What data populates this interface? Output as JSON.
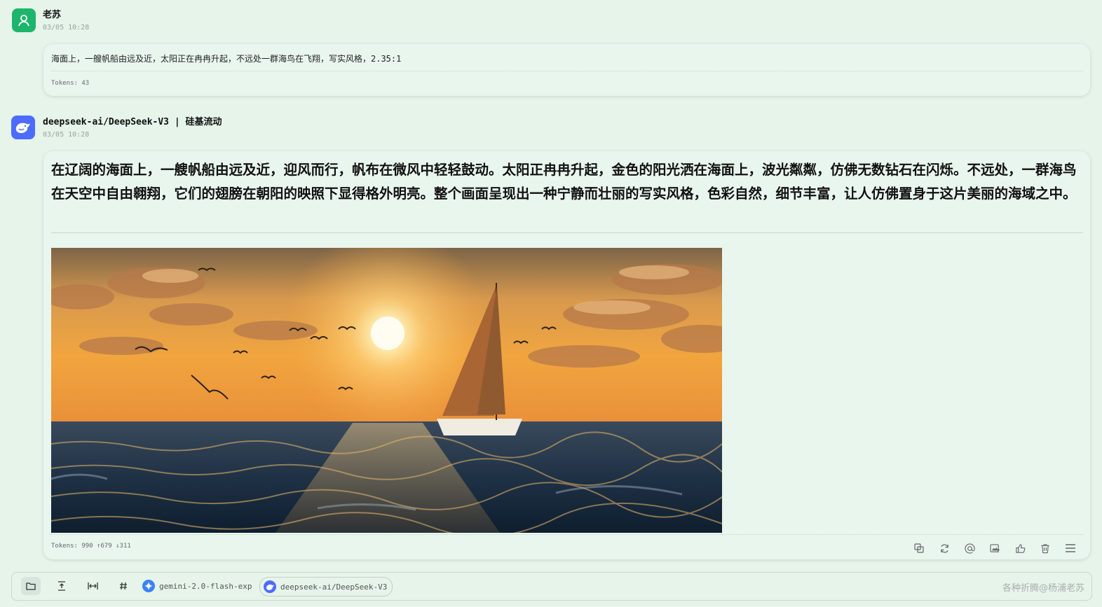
{
  "user_message": {
    "author": "老苏",
    "time": "03/05 10:28",
    "text": "海面上，一艘帆船由远及近，太阳正在冉冉升起，不远处一群海鸟在飞翔，写实风格，2.35:1",
    "tokens": "Tokens: 43"
  },
  "bot_message": {
    "author": "deepseek-ai/DeepSeek-V3 | 硅基流动",
    "time": "03/05 10:28",
    "text": "在辽阔的海面上，一艘帆船由远及近，迎风而行，帆布在微风中轻轻鼓动。太阳正冉冉升起，金色的阳光洒在海面上，波光粼粼，仿佛无数钻石在闪烁。不远处，一群海鸟在天空中自由翱翔，它们的翅膀在朝阳的映照下显得格外明亮。整个画面呈现出一种宁静而壮丽的写实风格，色彩自然，细节丰富，让人仿佛置身于这片美丽的海域之中。",
    "tokens": "Tokens: 990 ↑679 ↓311",
    "actions": [
      "copy-icon",
      "regenerate-icon",
      "mention-icon",
      "image-translate-icon",
      "thumbs-up-icon",
      "delete-icon",
      "menu-icon"
    ]
  },
  "toolbar": {
    "tools": [
      "folder-icon",
      "text-cursor-icon",
      "width-icon",
      "hash-icon"
    ],
    "models": [
      {
        "label": "gemini-2.0-flash-exp",
        "icon": "gemini-icon",
        "selected": false
      },
      {
        "label": "deepseek-ai/DeepSeek-V3",
        "icon": "deepseek-icon",
        "selected": true
      }
    ],
    "watermark": "各种折腾@杨浦老苏"
  },
  "colors": {
    "background": "#e6f4ea",
    "user_avatar": "#1db56b",
    "deepseek_blue": "#4d6bfe",
    "gemini_blue": "#3b82f6"
  }
}
